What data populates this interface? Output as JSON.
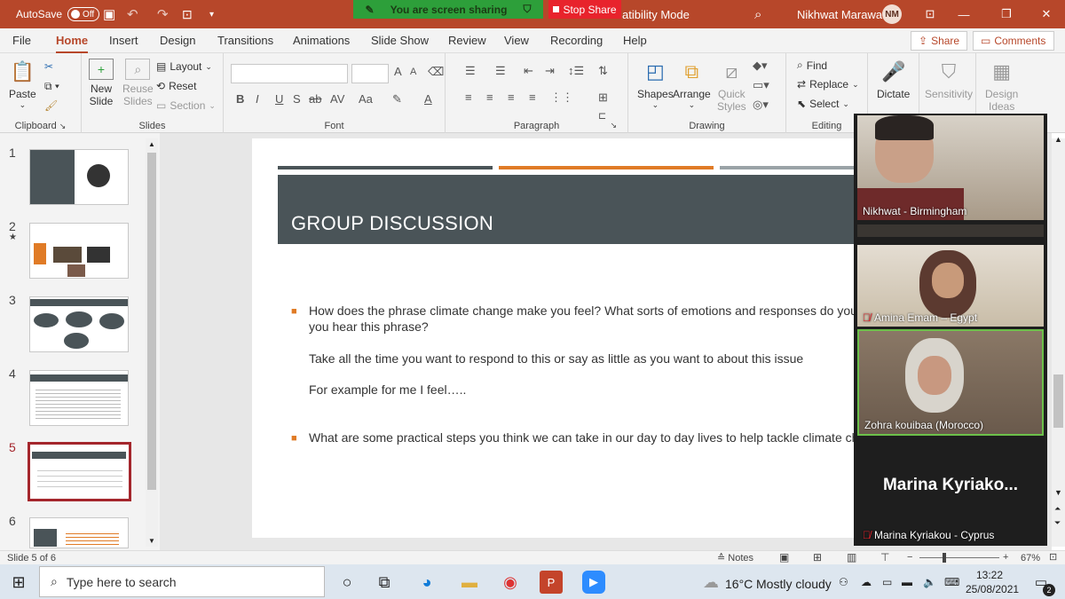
{
  "titlebar": {
    "autosave_label": "AutoSave",
    "autosave_state": "Off",
    "sharing_text": "You are screen sharing",
    "stop_share": "Stop Share",
    "mode_text": "atibility Mode",
    "user_name": "Nikhwat Marawat",
    "user_initials": "NM"
  },
  "menu": {
    "tabs": [
      "File",
      "Home",
      "Insert",
      "Design",
      "Transitions",
      "Animations",
      "Slide Show",
      "Review",
      "View",
      "Recording",
      "Help"
    ],
    "share": "Share",
    "comments": "Comments"
  },
  "ribbon": {
    "clipboard": {
      "label": "Clipboard",
      "paste": "Paste"
    },
    "slides": {
      "label": "Slides",
      "new_slide_1": "New",
      "new_slide_2": "Slide",
      "reuse_1": "Reuse",
      "reuse_2": "Slides",
      "layout": "Layout",
      "reset": "Reset",
      "section": "Section"
    },
    "font": {
      "label": "Font",
      "bold": "B",
      "italic": "I",
      "underline": "U",
      "strike": "ab",
      "spacing": "AV",
      "case": "Aa",
      "color": "A",
      "grow": "A",
      "shrink": "A"
    },
    "paragraph": {
      "label": "Paragraph"
    },
    "drawing": {
      "label": "Drawing",
      "shapes": "Shapes",
      "arrange": "Arrange",
      "quick_styles_1": "Quick",
      "quick_styles_2": "Styles"
    },
    "editing": {
      "label": "Editing",
      "find": "Find",
      "replace": "Replace",
      "select": "Select"
    },
    "voice": {
      "dictate": "Dictate"
    },
    "sensitivity": {
      "label": "Sensitivity"
    },
    "designer": {
      "label_1": "Design",
      "label_2": "Ideas"
    }
  },
  "thumbnails": [
    {
      "num": "1",
      "star": ""
    },
    {
      "num": "2",
      "star": "★"
    },
    {
      "num": "3",
      "star": ""
    },
    {
      "num": "4",
      "star": ""
    },
    {
      "num": "5",
      "star": ""
    },
    {
      "num": "6",
      "star": ""
    }
  ],
  "slide": {
    "title": "GROUP DISCUSSION",
    "bullet1_line1": "How does the phrase climate change make you feel?  What sorts of emotions and responses do you h",
    "bullet1_line2": "you hear this phrase?",
    "para1": "Take all the time you want to respond to this or say as little as you want to about this issue",
    "para2": "For example for me I feel…..",
    "bullet2": "What are some practical steps you think we can take in our day to day lives to help tackle climate cha",
    "bar_colors": [
      "#4a5458",
      "#e07b26",
      "#9aa3a7"
    ]
  },
  "participants": [
    {
      "name": "Nikhwat -  Birmingham",
      "muted": false
    },
    {
      "name": "Amina Emam – Egypt",
      "muted": true
    },
    {
      "name": "Zohra kouibaa (Morocco)",
      "muted": false
    },
    {
      "name": "Marina Kyriakou - Cyprus",
      "muted": true,
      "big_label": "Marina  Kyriako..."
    }
  ],
  "status": {
    "slide_info": "Slide 5 of 6",
    "notes": "Notes",
    "zoom": "67%"
  },
  "taskbar": {
    "search_placeholder": "Type here to search",
    "weather_temp": "16°C",
    "weather_desc": "Mostly cloudy",
    "time": "13:22",
    "date": "25/08/2021",
    "notif_count": "2"
  },
  "colors": {
    "accent": "#b7472a",
    "share_green": "#2d9f3a",
    "stop_red": "#e8232c",
    "slide_dark": "#4a5458",
    "slide_orange": "#e07b26"
  }
}
